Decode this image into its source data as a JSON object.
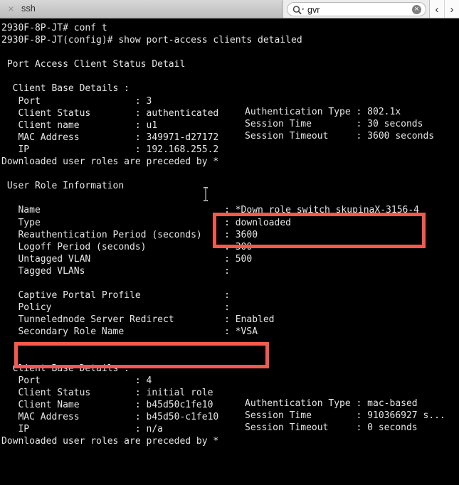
{
  "window": {
    "close_icon": "×",
    "tab_title": "ssh"
  },
  "search": {
    "icon": "search-icon",
    "value": "gvr",
    "clear_icon": "×",
    "prev_label": "‹",
    "next_label": "›"
  },
  "terminal": {
    "left_column": "2930F-8P-JT# conf t\n2930F-8P-JT(config)# show port-access clients detailed\n\n Port Access Client Status Detail\n\n  Client Base Details :\n   Port                 : 3\n   Client Status        : authenticated\n   Client name          : u1\n   MAC Address          : 349971-d27172\n   IP                   : 192.168.255.2\nDownloaded user roles are preceded by *\n\n User Role Information\n\n   Name                                 : *Down_role_switch_skupinaX-3156-4\n   Type                                 : downloaded\n   Reauthentication Period (seconds)    : 3600\n   Logoff Period (seconds)              : 300\n   Untagged VLAN                        : 500\n   Tagged VLANs                         :\n\n   Captive Portal Profile               :\n   Policy                               :\n   Tunnelednode Server Redirect         : Enabled\n   Secondary Role Name                  : *VSA\n\n\n  Client Base Details :\n   Port                 : 4\n   Client Status        : initial role\n   Client Name          : b45d50c1fe10\n   MAC Address          : b45d50-c1fe10\n   IP                   : n/a\nDownloaded user roles are preceded by *",
    "client1_right_column": "Authentication Type : 802.1x\nSession Time        : 30 seconds\nSession Timeout     : 3600 seconds",
    "client2_right_column": "Authentication Type : mac-based\nSession Time        : 910366927 s...\nSession Timeout     : 0 seconds",
    "prompt_lines": [
      "2930F-8P-JT# conf t",
      "2930F-8P-JT(config)# show port-access clients detailed"
    ],
    "section_title": "Port Access Client Status Detail",
    "user_role_section_title": "User Role Information",
    "footer_note": "Downloaded user roles are preceded by *",
    "client1": {
      "header": "Client Base Details :",
      "port": "3",
      "client_status": "authenticated",
      "client_name": "u1",
      "mac_address": "349971-d27172",
      "ip": "192.168.255.2",
      "authentication_type": "802.1x",
      "session_time": "30 seconds",
      "session_timeout": "3600 seconds"
    },
    "user_role": {
      "name": "*Down_role_switch_skupinaX-3156-4",
      "type": "downloaded",
      "reauthentication_period_seconds": "3600",
      "logoff_period_seconds": "300",
      "untagged_vlan": "500",
      "tagged_vlans": "",
      "captive_portal_profile": "",
      "policy": "",
      "tunnelednode_server_redirect": "Enabled",
      "secondary_role_name": "*VSA"
    },
    "client2": {
      "header": "Client Base Details :",
      "port": "4",
      "client_status": "initial role",
      "client_name": "b45d50c1fe10",
      "mac_address": "b45d50-c1fe10",
      "ip": "n/a",
      "authentication_type": "mac-based",
      "session_time": "910366927 s...",
      "session_timeout": "0 seconds"
    }
  },
  "annotations": {
    "highlight_color": "#f4584f",
    "boxes": [
      {
        "name": "user-role-name-highlight",
        "target": "*Down_role_switch_skupinaX-3156-4 / downloaded"
      },
      {
        "name": "secondary-role-name-highlight",
        "target": "Secondary Role Name : *VSA"
      }
    ]
  },
  "colors": {
    "terminal_background": "#000000",
    "terminal_text": "#e6e6e6",
    "titlebar_background": "#c8c8c8",
    "accent_red": "#f4584f"
  }
}
